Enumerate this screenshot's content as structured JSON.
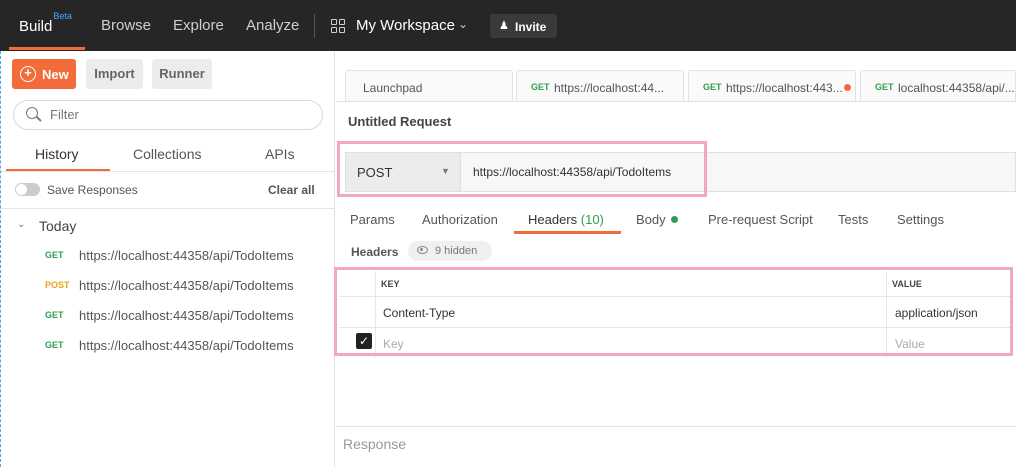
{
  "topbar": {
    "build": "Build",
    "beta": "Beta",
    "browse": "Browse",
    "explore": "Explore",
    "analyze": "Analyze",
    "workspace": "My Workspace",
    "invite": "Invite",
    "accent": "#f26b3a"
  },
  "sidebar": {
    "new_label": "New",
    "import_label": "Import",
    "runner_label": "Runner",
    "filter_placeholder": "Filter",
    "tabs": [
      "History",
      "Collections",
      "APIs"
    ],
    "save_responses": "Save Responses",
    "clear_all": "Clear all",
    "group_label": "Today",
    "history": [
      {
        "method": "GET",
        "url": "https://localhost:44358/api/TodoItems"
      },
      {
        "method": "POST",
        "url": "https://localhost:44358/api/TodoItems"
      },
      {
        "method": "GET",
        "url": "https://localhost:44358/api/TodoItems"
      },
      {
        "method": "GET",
        "url": "https://localhost:44358/api/TodoItems"
      }
    ]
  },
  "request_tabs": [
    {
      "label": "Launchpad"
    },
    {
      "method": "GET",
      "label": "https://localhost:44..."
    },
    {
      "method": "GET",
      "label": "https://localhost:443..."
    },
    {
      "method": "GET",
      "label": "localhost:44358/api/..."
    }
  ],
  "request": {
    "title": "Untitled Request",
    "method": "POST",
    "url": "https://localhost:44358/api/TodoItems"
  },
  "subtabs": {
    "params": "Params",
    "authorization": "Authorization",
    "headers": "Headers",
    "headers_count": "(10)",
    "body": "Body",
    "prerequest": "Pre-request Script",
    "tests": "Tests",
    "settings": "Settings"
  },
  "headers_section": {
    "label": "Headers",
    "hidden": "9 hidden",
    "col_key": "KEY",
    "col_value": "VALUE",
    "rows": [
      {
        "key": "Content-Type",
        "value": "application/json",
        "checked": true
      }
    ],
    "key_placeholder": "Key",
    "value_placeholder": "Value"
  },
  "response": {
    "label": "Response"
  }
}
